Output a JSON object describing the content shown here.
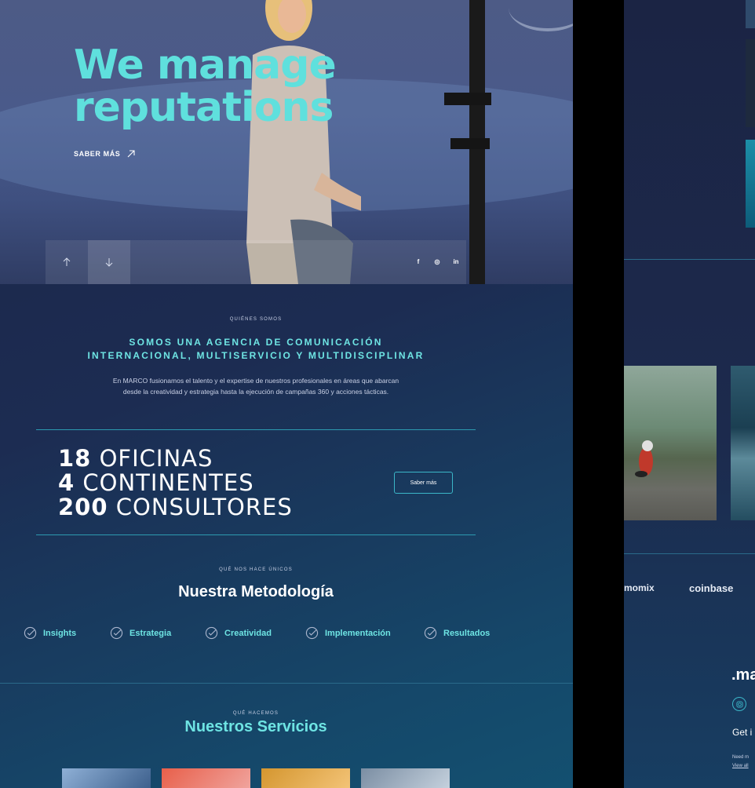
{
  "hero": {
    "title": "We manage reputations",
    "cta_label": "SABER MÁS",
    "social": [
      "f",
      "◎",
      "in"
    ]
  },
  "about": {
    "eyebrow": "QUIÉNES SOMOS",
    "title_line1": "SOMOS UNA AGENCIA DE COMUNICACIÓN",
    "title_line2": "INTERNACIONAL, MULTISERVICIO Y MULTIDISCIPLINAR",
    "desc_line1": "En MARCO fusionamos el talento y el expertise de nuestros profesionales en áreas que abarcan",
    "desc_line2": "desde la creatividad y estrategia hasta la ejecución de campañas 360 y acciones tácticas."
  },
  "stats": {
    "items": [
      {
        "number": "18",
        "label": "OFICINAS"
      },
      {
        "number": "4",
        "label": "CONTINENTES"
      },
      {
        "number": "200",
        "label": "CONSULTORES"
      }
    ],
    "button_label": "Saber más"
  },
  "methodology": {
    "eyebrow": "QUÉ NOS HACE ÚNICOS",
    "title": "Nuestra Metodología",
    "items": [
      "Insights",
      "Estrategia",
      "Creatividad",
      "Implementación",
      "Resultados"
    ]
  },
  "services": {
    "eyebrow": "QUÉ HACEMOS",
    "title": "Nuestros Servicios"
  },
  "right_panel": {
    "logos": [
      "momix",
      "coinbase"
    ],
    "brand": ".ma",
    "get_text": "Get i",
    "small_line1": "Need m",
    "small_line2": "View all"
  }
}
